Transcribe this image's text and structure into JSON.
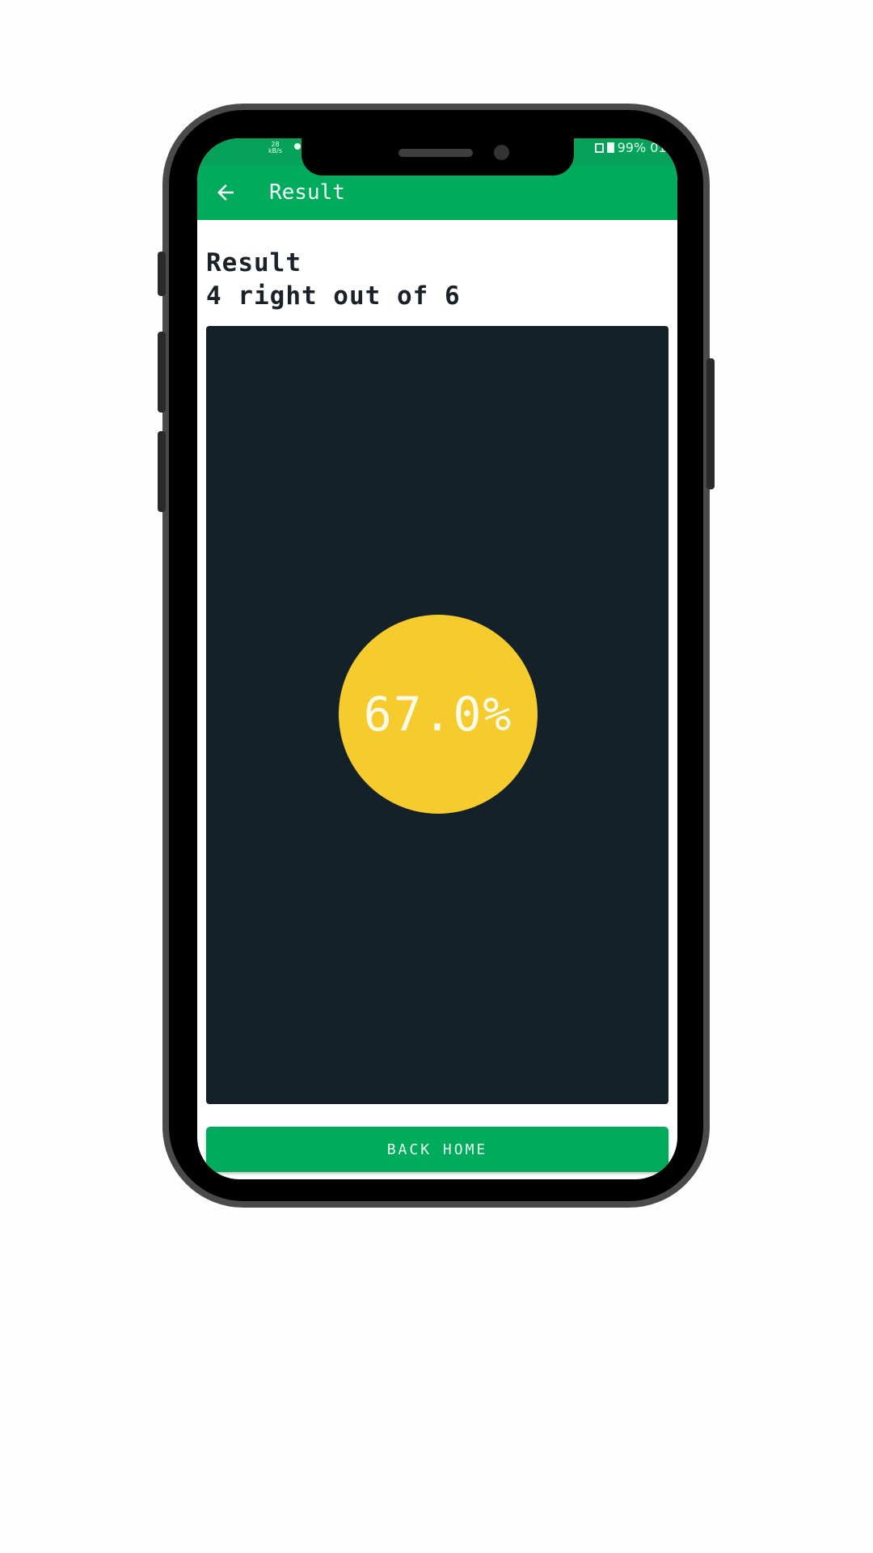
{
  "status_bar": {
    "speed_value": "28",
    "speed_unit": "kB/s",
    "battery": "99% 01:"
  },
  "appbar": {
    "title": "Result"
  },
  "result": {
    "heading": "Result",
    "summary": "4 right out of 6",
    "score": "67.0%",
    "score_fraction": 0.67
  },
  "actions": {
    "back_home_label": "BACK HOME"
  },
  "colors": {
    "primary": "#00ab5c",
    "panel": "#152128",
    "accent": "#f5cb2d"
  },
  "icons": {
    "back": "arrow-left-icon"
  }
}
